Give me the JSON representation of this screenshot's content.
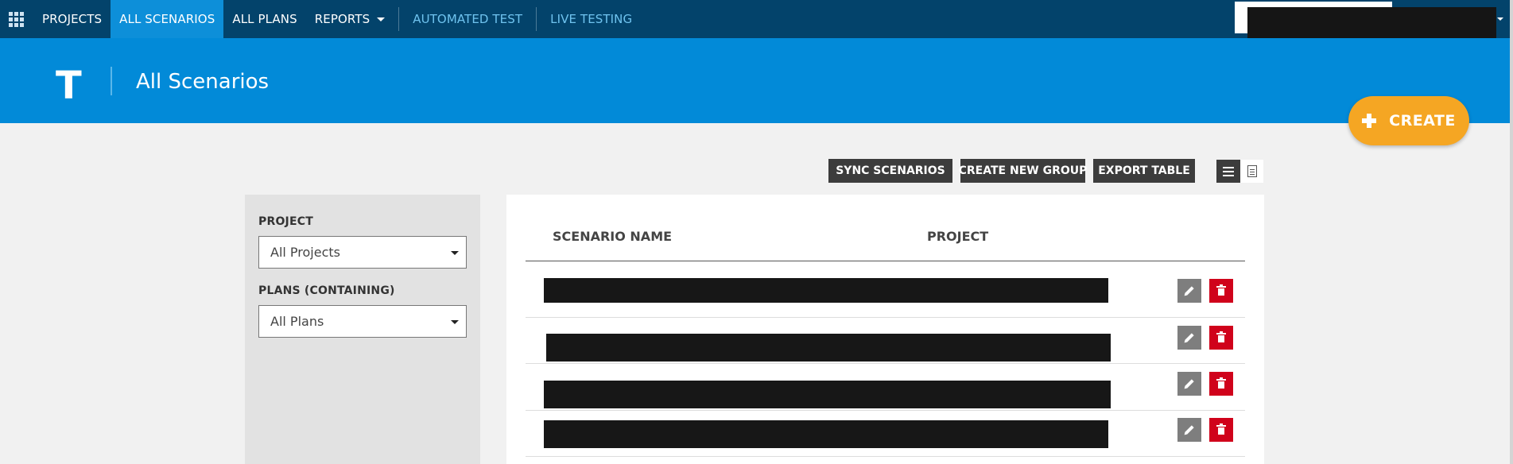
{
  "topnav": {
    "items": [
      {
        "label": "PROJECTS"
      },
      {
        "label": "ALL SCENARIOS"
      },
      {
        "label": "ALL PLANS"
      },
      {
        "label": "REPORTS"
      },
      {
        "label": "AUTOMATED TEST"
      },
      {
        "label": "LIVE TESTING"
      }
    ],
    "active_item": "ALL SCENARIOS",
    "icons": [
      "apps-grid-icon",
      "chevron-down-icon"
    ]
  },
  "header": {
    "logo": "T",
    "title": "All Scenarios"
  },
  "create_button": {
    "label": "CREATE",
    "icon": "plus-icon"
  },
  "toolbar": {
    "sync_label": "SYNC SCENARIOS",
    "new_group_label": "CREATE NEW GROUP",
    "export_label": "EXPORT TABLE",
    "view_icons": [
      "list-view-icon",
      "document-view-icon"
    ]
  },
  "filters": {
    "project_label": "PROJECT",
    "project_value": "All Projects",
    "plans_label": "PLANS (CONTAINING)",
    "plans_value": "All Plans"
  },
  "table": {
    "columns": [
      "SCENARIO NAME",
      "PROJECT"
    ],
    "rows": [
      {
        "icons": [
          "pencil-icon",
          "trash-icon"
        ]
      },
      {
        "icons": [
          "pencil-icon",
          "trash-icon"
        ]
      },
      {
        "icons": [
          "pencil-icon",
          "trash-icon"
        ]
      },
      {
        "icons": [
          "pencil-icon",
          "trash-icon"
        ]
      }
    ]
  },
  "colors": {
    "nav_bg": "#03436b",
    "nav_active": "#0d8fd9",
    "header_bg": "#028ad8",
    "create_orange": "#f5a623",
    "delete_red": "#d0021b",
    "button_dark": "#3c3c3c"
  }
}
